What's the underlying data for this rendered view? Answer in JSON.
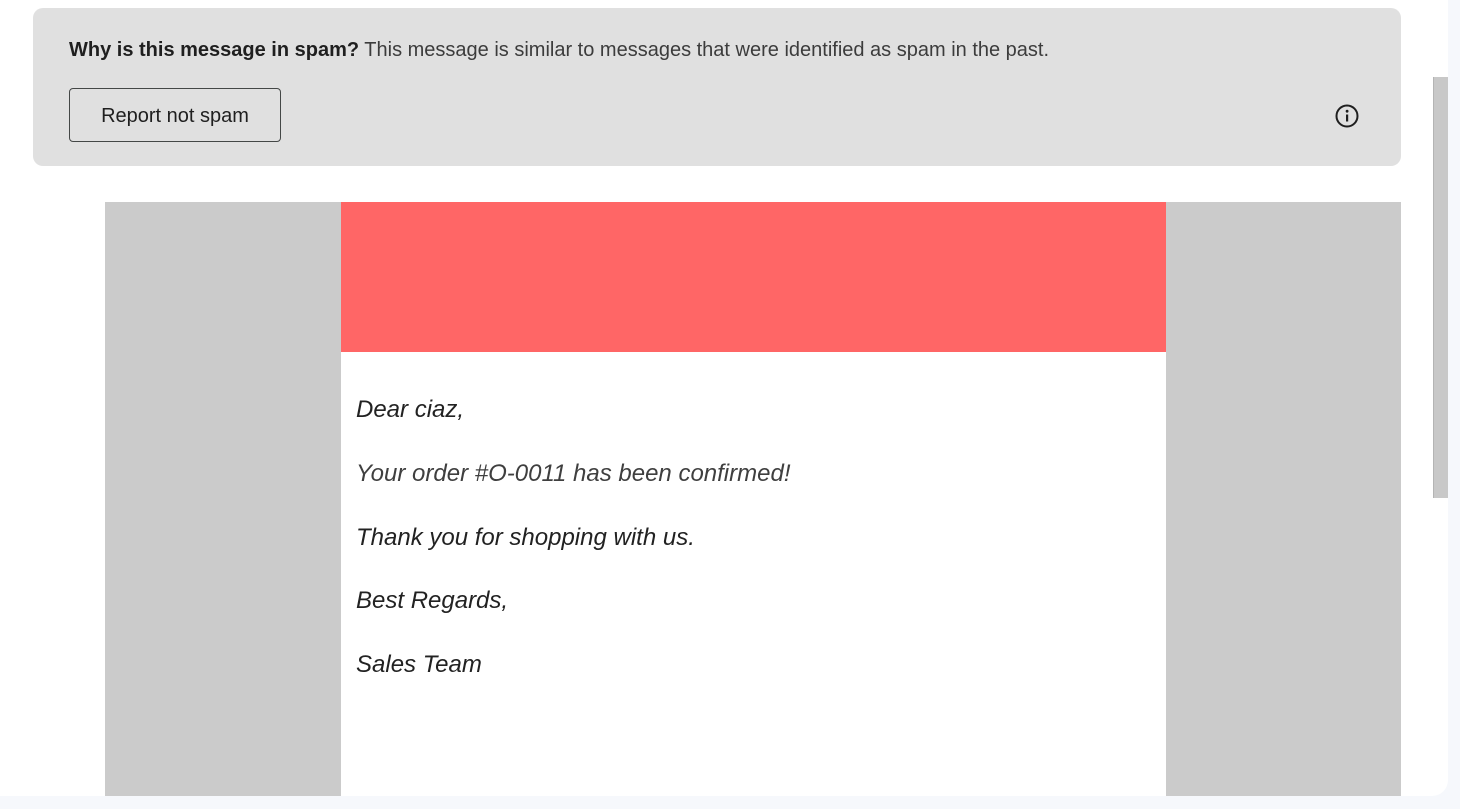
{
  "spam_banner": {
    "question": "Why is this message in spam?",
    "explanation": "This message is similar to messages that were identified as spam in the past.",
    "report_button_label": "Report not spam",
    "info_icon": "info-icon"
  },
  "email": {
    "header_color": "#ff6666",
    "frame_color": "#cbcbcb",
    "greeting": "Dear ciaz,",
    "order_line": "Your order #O-0011 has been confirmed!",
    "thanks_line": "Thank you for shopping with us.",
    "closing": "Best Regards,",
    "signature": "Sales Team"
  }
}
